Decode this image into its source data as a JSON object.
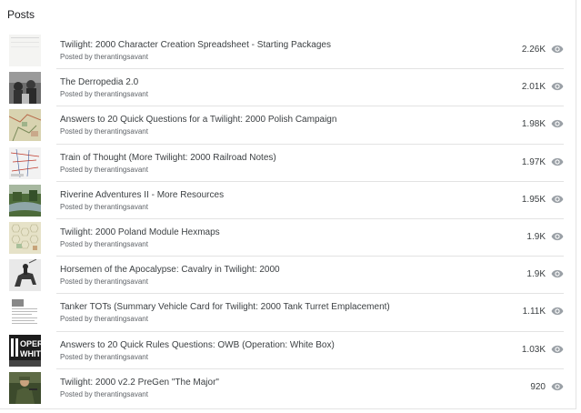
{
  "header": {
    "title": "Posts"
  },
  "icons": {
    "views": "eye-icon"
  },
  "posts": [
    {
      "title": "Twilight: 2000 Character Creation Spreadsheet - Starting Packages",
      "author": "Posted by therantingsavant",
      "views": "2.26K",
      "thumb": "spreadsheet"
    },
    {
      "title": "The Derropedia 2.0",
      "author": "Posted by therantingsavant",
      "views": "2.01K",
      "thumb": "bw-photo"
    },
    {
      "title": "Answers to 20 Quick Questions for a Twilight: 2000 Polish Campaign",
      "author": "Posted by therantingsavant",
      "views": "1.98K",
      "thumb": "map"
    },
    {
      "title": "Train of Thought (More Twilight: 2000 Railroad Notes)",
      "author": "Posted by therantingsavant",
      "views": "1.97K",
      "thumb": "rail-map"
    },
    {
      "title": "Riverine Adventures II - More Resources",
      "author": "Posted by therantingsavant",
      "views": "1.95K",
      "thumb": "river"
    },
    {
      "title": "Twilight: 2000 Poland Module Hexmaps",
      "author": "Posted by therantingsavant",
      "views": "1.9K",
      "thumb": "hexmap"
    },
    {
      "title": "Horsemen of the Apocalypse: Cavalry in Twilight: 2000",
      "author": "Posted by therantingsavant",
      "views": "1.9K",
      "thumb": "cavalry"
    },
    {
      "title": "Tanker TOTs (Summary Vehicle Card for Twilight: 2000 Tank Turret Emplacement)",
      "author": "Posted by therantingsavant",
      "views": "1.11K",
      "thumb": "document"
    },
    {
      "title": "Answers to 20 Quick Rules Questions: OWB (Operation: White Box)",
      "author": "Posted by therantingsavant",
      "views": "1.03K",
      "thumb": "operation"
    },
    {
      "title": "Twilight: 2000 v2.2 PreGen \"The Major\"",
      "author": "Posted by therantingsavant",
      "views": "920",
      "thumb": "soldier"
    }
  ]
}
